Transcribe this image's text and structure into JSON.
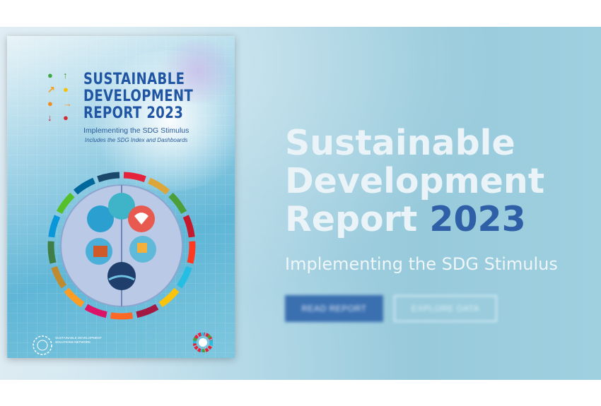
{
  "cover": {
    "title_line1": "SUSTAINABLE",
    "title_line2": "DEVELOPMENT",
    "title_line3_prefix": "REPORT",
    "title_year": "2023",
    "subtitle": "Implementing the SDG Stimulus",
    "tagline": "Includes the SDG Index and Dashboards",
    "publisher": "SUSTAINABLE DEVELOPMENT SOLUTIONS NETWORK"
  },
  "hero": {
    "title_line1": "Sustainable",
    "title_line2": "Development",
    "title_line3_prefix": "Report",
    "title_year": "2023",
    "subtitle": "Implementing the SDG Stimulus"
  },
  "buttons": {
    "read_report": "READ REPORT",
    "explore_data": "EXPLORE DATA"
  },
  "colors": {
    "accent_blue": "#2f5fa6",
    "button_blue": "#3a6fb0"
  }
}
